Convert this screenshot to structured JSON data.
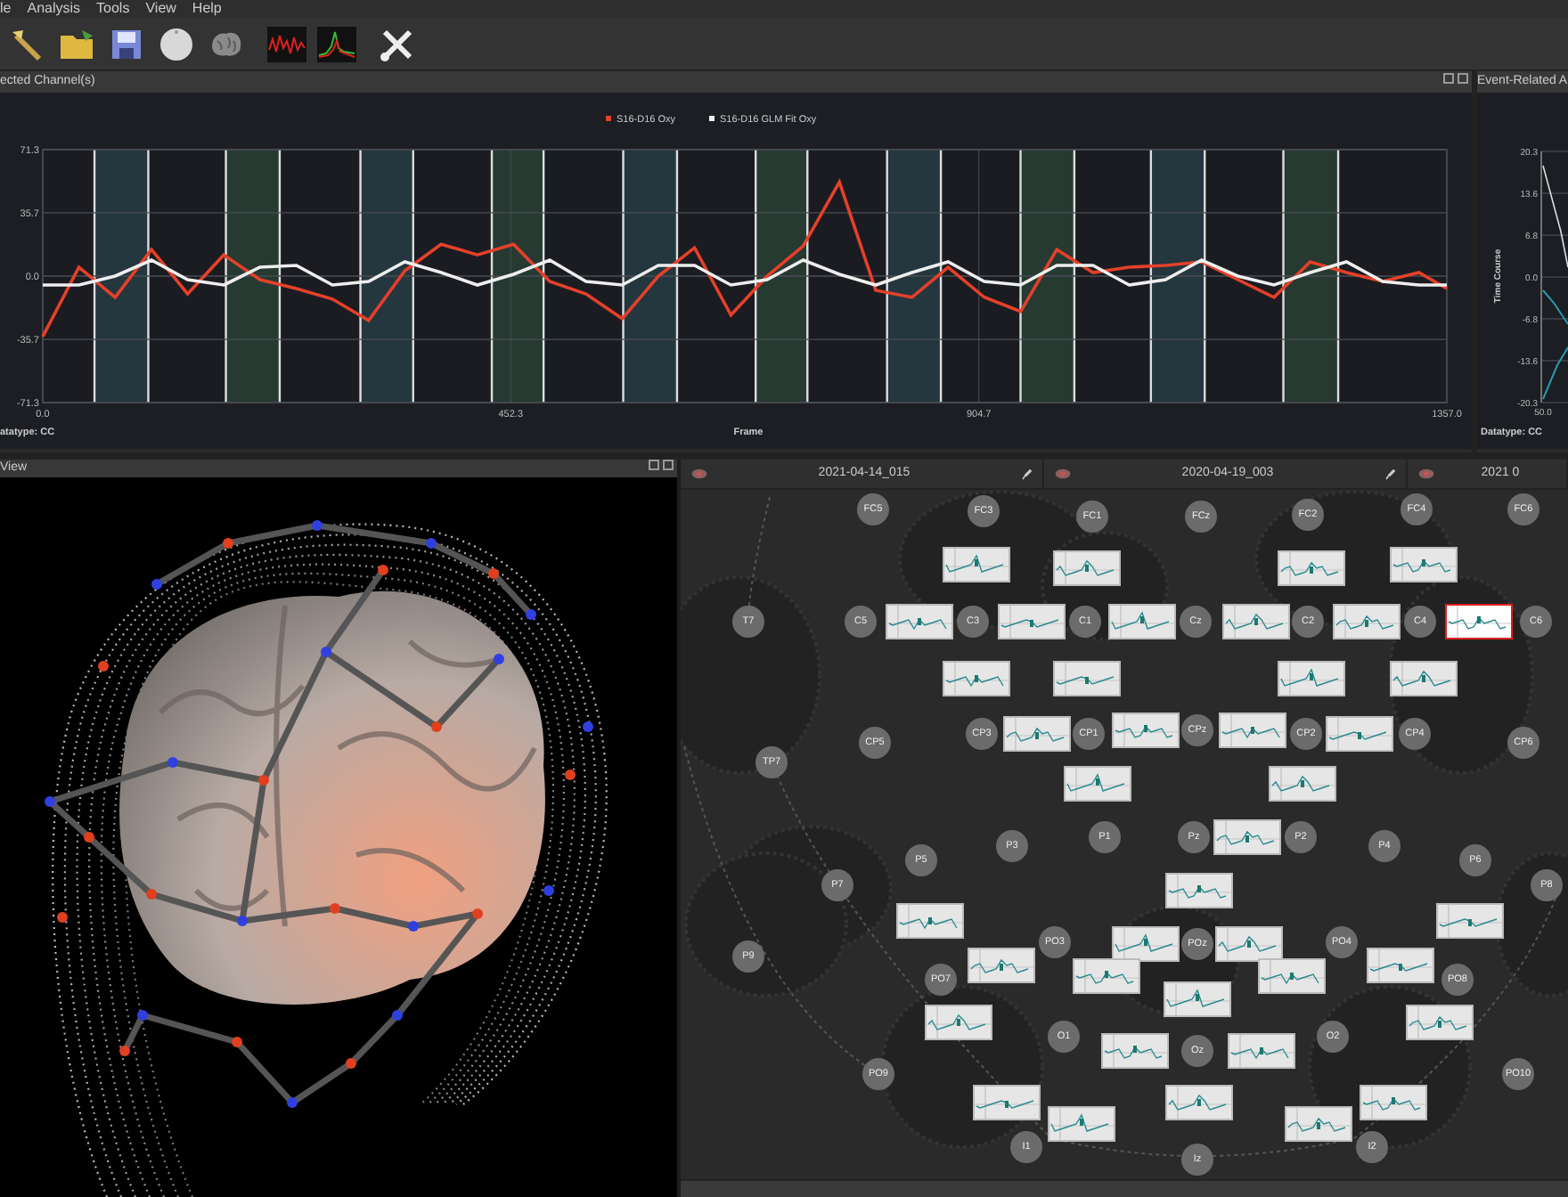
{
  "menu_bar": {
    "items": [
      "le",
      "Analysis",
      "Tools",
      "View",
      "Help"
    ]
  },
  "channel_panel": {
    "title": "ected Channel(s)",
    "datatype": "atatype: CC",
    "chart_data": {
      "type": "line",
      "xlabel": "Frame",
      "xlim": [
        0,
        1357
      ],
      "ylim": [
        -71.3,
        71.3
      ],
      "xticks": [
        {
          "value": 0,
          "label": "0.0"
        },
        {
          "value": 452.3,
          "label": "452.3"
        },
        {
          "value": 904.7,
          "label": "904.7"
        },
        {
          "value": 1357,
          "label": "1357.0"
        }
      ],
      "yticks": [
        {
          "value": 71.3,
          "label": "71.3"
        },
        {
          "value": 35.7,
          "label": "35.7"
        },
        {
          "value": 0,
          "label": "0.0"
        },
        {
          "value": -35.7,
          "label": "-35.7"
        },
        {
          "value": -71.3,
          "label": "-71.3"
        }
      ],
      "x": [
        0,
        35,
        70,
        105,
        140,
        175,
        210,
        245,
        280,
        315,
        350,
        385,
        420,
        455,
        490,
        525,
        560,
        595,
        630,
        665,
        700,
        735,
        770,
        805,
        840,
        875,
        910,
        945,
        980,
        1015,
        1050,
        1085,
        1120,
        1155,
        1190,
        1225,
        1260,
        1295,
        1330,
        1357
      ],
      "series": [
        {
          "name": "S16-D16 Oxy",
          "color": "#e5402a",
          "values": [
            -34,
            5,
            -12,
            15,
            -10,
            12,
            -2,
            -7,
            -13,
            -25,
            3,
            18,
            12,
            18,
            -3,
            -10,
            -24,
            0,
            16,
            -22,
            0,
            17,
            53,
            -8,
            -12,
            5,
            -12,
            -20,
            15,
            2,
            5,
            6,
            8,
            -2,
            -12,
            8,
            2,
            -3,
            2,
            -7
          ]
        },
        {
          "name": "S16-D16 GLM Fit Oxy",
          "color": "#eeeeee",
          "values": [
            -5,
            -5,
            0,
            9,
            -2,
            -5,
            5,
            6,
            -5,
            -3,
            8,
            2,
            -5,
            1,
            9,
            -3,
            -5,
            6,
            6,
            -5,
            -2,
            9,
            1,
            -5,
            2,
            8,
            -3,
            -5,
            6,
            6,
            -5,
            -2,
            9,
            0,
            -5,
            2,
            8,
            -3,
            -5,
            -5
          ]
        }
      ],
      "grid": true,
      "legend": true,
      "bands": [
        {
          "axis": "x",
          "from": 50,
          "to": 102,
          "color": "#24363e"
        },
        {
          "axis": "x",
          "from": 177,
          "to": 229,
          "color": "#263a32"
        },
        {
          "axis": "x",
          "from": 307,
          "to": 358,
          "color": "#24363e"
        },
        {
          "axis": "x",
          "from": 434,
          "to": 484,
          "color": "#263a32"
        },
        {
          "axis": "x",
          "from": 561,
          "to": 613,
          "color": "#24363e"
        },
        {
          "axis": "x",
          "from": 689,
          "to": 739,
          "color": "#263a32"
        },
        {
          "axis": "x",
          "from": 816,
          "to": 868,
          "color": "#24363e"
        },
        {
          "axis": "x",
          "from": 945,
          "to": 997,
          "color": "#263a32"
        },
        {
          "axis": "x",
          "from": 1071,
          "to": 1123,
          "color": "#24363e"
        },
        {
          "axis": "x",
          "from": 1199,
          "to": 1252,
          "color": "#263a32"
        }
      ]
    }
  },
  "event_panel": {
    "title": "Event-Related A",
    "ylabel": "Time Course",
    "y_ticks": [
      "20.3",
      "13.6",
      "6.8",
      "0.0",
      "-6.8",
      "-13.6",
      "-20.3"
    ],
    "x_tick": "50.0",
    "datatype": "Datatype: CC"
  },
  "view_panel": {
    "title": "View"
  },
  "montage_panel": {
    "tabs": [
      {
        "label": "2021-04-14_015"
      },
      {
        "label": "2020-04-19_003"
      },
      {
        "label": "2021 0"
      }
    ],
    "channels": [
      "FC5",
      "FC3",
      "FC1",
      "FCz",
      "FC2",
      "FC4",
      "FC6",
      "T7",
      "C5",
      "C3",
      "C1",
      "Cz",
      "C2",
      "C4",
      "C6",
      "TP7",
      "CP5",
      "CP3",
      "CP1",
      "CPz",
      "CP2",
      "CP4",
      "CP6",
      "P7",
      "P5",
      "P3",
      "P1",
      "Pz",
      "P2",
      "P4",
      "P6",
      "P8",
      "P9",
      "PO7",
      "PO3",
      "POz",
      "PO4",
      "PO8",
      "O1",
      "Oz",
      "O2",
      "PO9",
      "PO10",
      "I1",
      "Iz",
      "I2"
    ],
    "mini_plots": [
      {
        "selected": false
      },
      {
        "selected": false
      },
      {
        "selected": false
      },
      {
        "selected": false
      },
      {
        "selected": false
      },
      {
        "selected": false
      },
      {
        "selected": false
      },
      {
        "selected": false
      },
      {
        "selected": false
      },
      {
        "selected": true
      },
      {
        "selected": false
      },
      {
        "selected": false
      },
      {
        "selected": false
      },
      {
        "selected": false
      },
      {
        "selected": false
      },
      {
        "selected": false
      },
      {
        "selected": false
      },
      {
        "selected": false
      },
      {
        "selected": false
      },
      {
        "selected": false
      },
      {
        "selected": false
      },
      {
        "selected": false
      },
      {
        "selected": false
      },
      {
        "selected": false
      },
      {
        "selected": false
      },
      {
        "selected": false
      },
      {
        "selected": false
      },
      {
        "selected": false
      },
      {
        "selected": false
      },
      {
        "selected": false
      },
      {
        "selected": false
      },
      {
        "selected": false
      },
      {
        "selected": false
      },
      {
        "selected": false
      },
      {
        "selected": false
      },
      {
        "selected": false
      },
      {
        "selected": false
      },
      {
        "selected": false
      },
      {
        "selected": false
      },
      {
        "selected": false
      }
    ]
  }
}
